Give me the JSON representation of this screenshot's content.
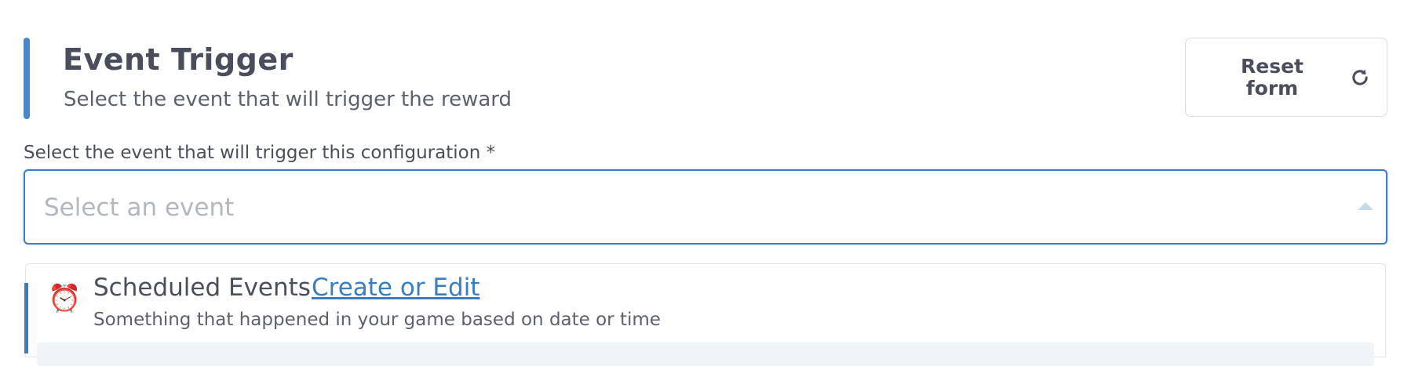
{
  "header": {
    "title": "Event Trigger",
    "subtitle": "Select the event that will trigger the reward",
    "accent_color": "#4a86c8"
  },
  "reset_button": {
    "label": "Reset form",
    "icon": "refresh-icon"
  },
  "event_field": {
    "label": "Select the event that will trigger this configuration *",
    "placeholder": "Select an event",
    "value": "",
    "border_color": "#3a7dc2",
    "arrow_icon": "caret-up-icon"
  },
  "dropdown": {
    "groups": [
      {
        "icon": "alarm-clock-icon",
        "icon_glyph": "⏰",
        "title": "Scheduled Events",
        "link": "Create or Edit",
        "description": "Something that happened in your game based on date or time"
      }
    ]
  }
}
